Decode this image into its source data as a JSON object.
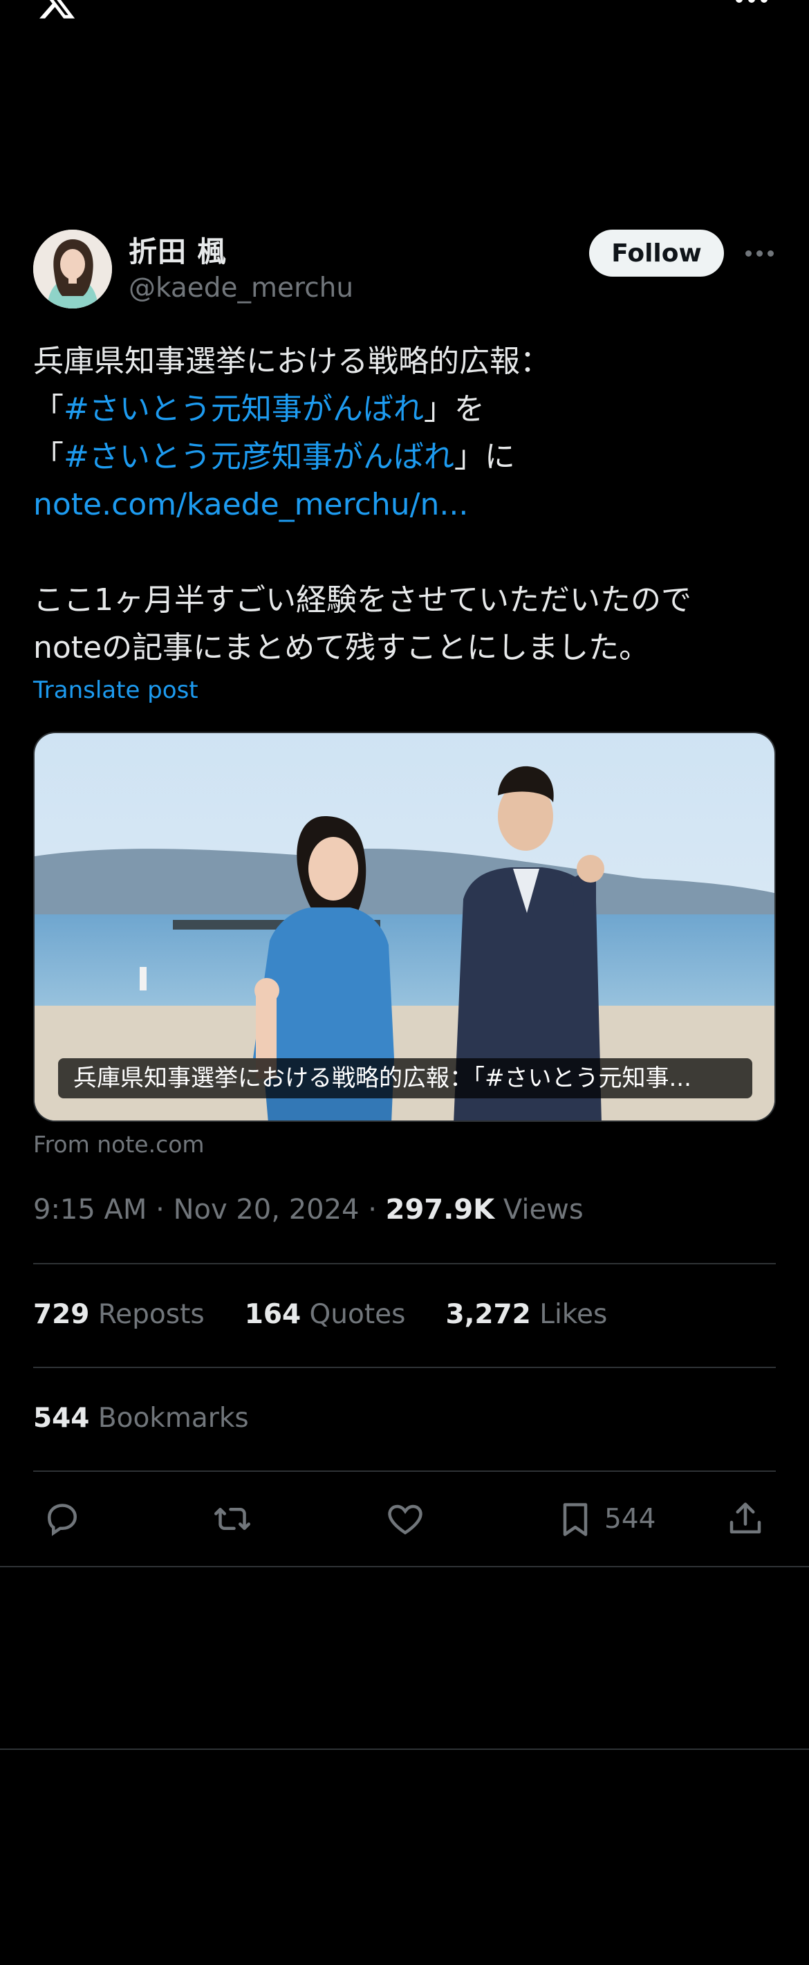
{
  "header": {
    "logo_icon": "x-logo-icon",
    "more_icon": "more-horizontal-icon"
  },
  "author": {
    "display_name": "折田 楓",
    "handle": "@kaede_merchu",
    "follow_label": "Follow"
  },
  "post": {
    "lines": [
      {
        "pre": "兵庫県知事選挙における戦略的広報：",
        "link": "",
        "post": ""
      },
      {
        "pre": "「",
        "link": "#さいとう元知事がんばれ",
        "post": "」を"
      },
      {
        "pre": "「",
        "link": "#さいとう元彦知事がんばれ",
        "post": "」に"
      },
      {
        "pre": "",
        "link": "note.com/kaede_merchu/n...",
        "post": ""
      }
    ],
    "body_lines": [
      "ここ1ヶ月半すごい経験をさせていただいたので",
      "noteの記事にまとめて残すことにしました。"
    ],
    "translate_label": "Translate post"
  },
  "card": {
    "caption": "兵庫県知事選挙における戦略的広報：「#さいとう元知事...",
    "source": "From note.com"
  },
  "meta": {
    "time": "9:15 AM",
    "separator": "·",
    "date": "Nov 20, 2024",
    "views_count": "297.9K",
    "views_label": "Views"
  },
  "stats": {
    "reposts_count": "729",
    "reposts_label": "Reposts",
    "quotes_count": "164",
    "quotes_label": "Quotes",
    "likes_count": "3,272",
    "likes_label": "Likes",
    "bookmarks_count": "544",
    "bookmarks_label": "Bookmarks"
  },
  "actions": {
    "reply_icon": "reply-icon",
    "repost_icon": "repost-icon",
    "like_icon": "heart-icon",
    "bookmark_icon": "bookmark-icon",
    "bookmark_count": "544",
    "share_icon": "share-icon"
  },
  "colors": {
    "background": "#000000",
    "text": "#e7e9ea",
    "secondary": "#71767b",
    "link": "#1d9bf0",
    "divider": "#2f3336"
  }
}
